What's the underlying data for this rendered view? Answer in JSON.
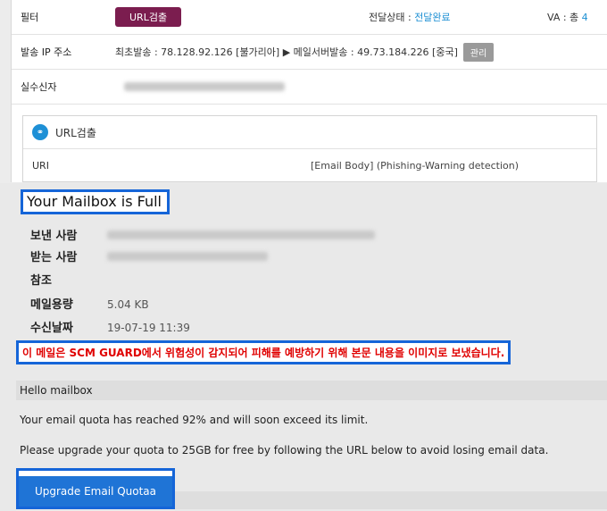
{
  "filter": {
    "label": "필터",
    "badge": "URL검출",
    "status_label": "전달상태 : ",
    "status_value": "전달완료",
    "va_label": "VA : 총 ",
    "va_value": "4"
  },
  "ip": {
    "label": "발송 IP 주소",
    "info": "최초발송 : 78.128.92.126 [불가리아] ▶ 메일서버발송 : 49.73.184.226 [중국]",
    "manage": "관리"
  },
  "sender_row": {
    "label": "실수신자"
  },
  "url_section": {
    "title": "URL검출",
    "uri_label": "URI",
    "uri_value": "[Email Body] (Phishing-Warning detection)"
  },
  "email": {
    "subject": "Your Mailbox is Full",
    "from_label": "보낸 사람",
    "to_label": "받는 사람",
    "cc_label": "참조",
    "size_label": "메일용량",
    "size_value": "5.04 KB",
    "date_label": "수신날짜",
    "date_value": "19-07-19 11:39",
    "warning": "이 메일은 SCM GUARD에서 위험성이 감지되어 피해를 예방하기 위해 본문 내용을 이미지로 보냈습니다.",
    "greeting": "Hello mailbox",
    "body_line1": "Your email quota has reached 92% and will soon exceed its limit.",
    "body_line2": "Please upgrade your quota to 25GB for free by following the URL below to avoid losing email data.",
    "cta": "Upgrade Email Quotaa"
  },
  "colors": {
    "badge": "#7b1d4f",
    "status": "#1c8fd3",
    "highlight_border": "#1565d8",
    "warning_text": "#e00000",
    "cta": "#1f74d6"
  }
}
